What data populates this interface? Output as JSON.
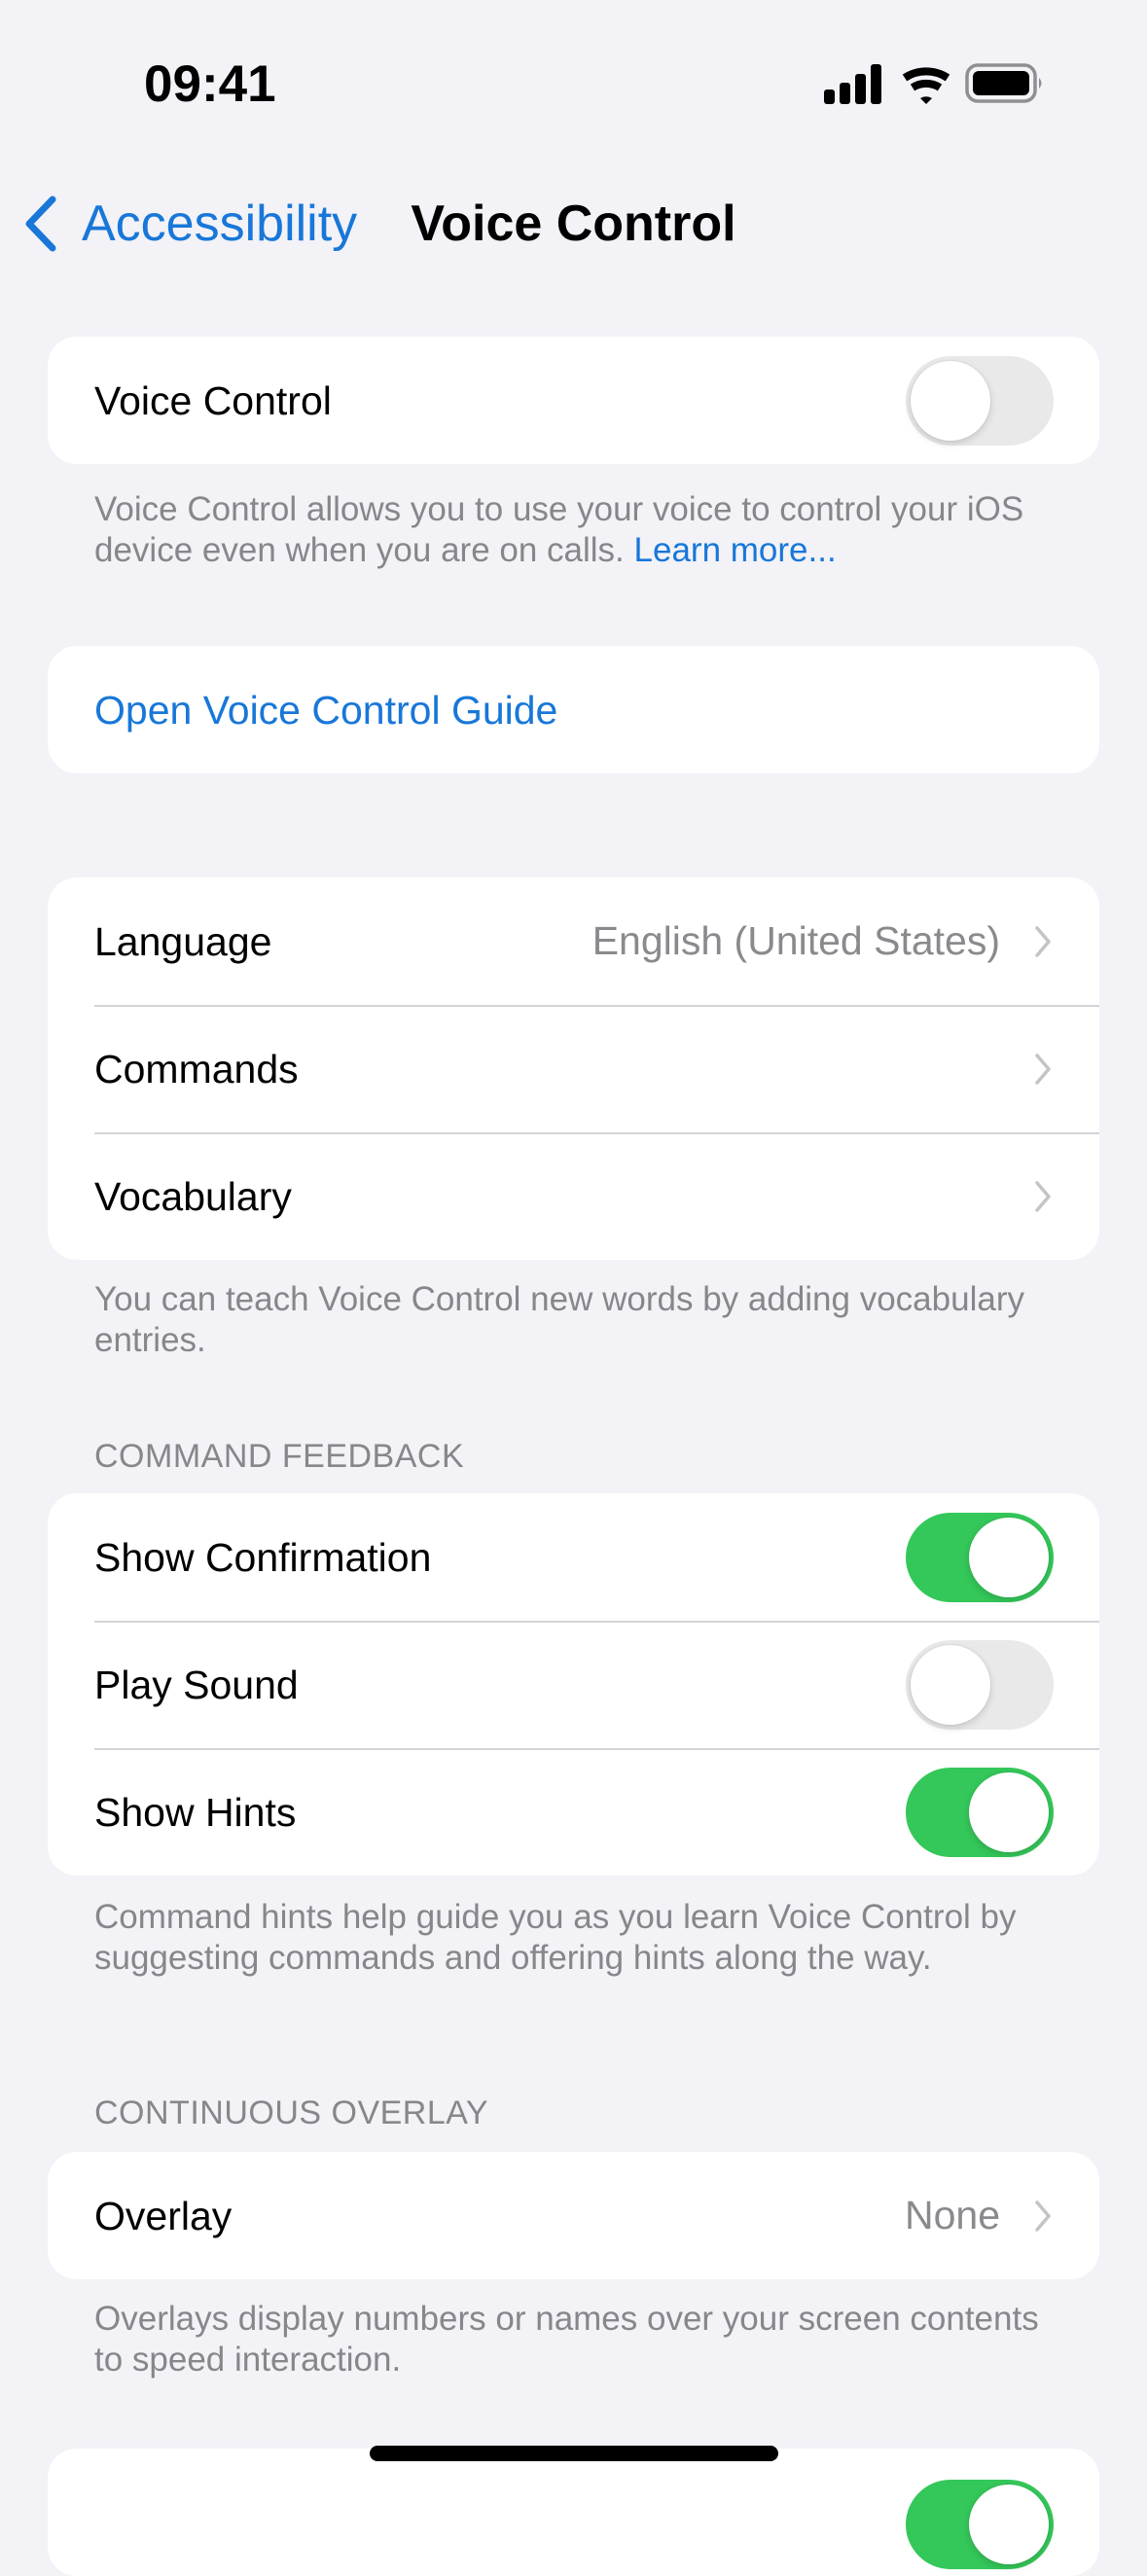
{
  "status_bar": {
    "time": "09:41",
    "icons": [
      "cellular-signal-icon",
      "wifi-icon",
      "battery-icon"
    ]
  },
  "nav": {
    "back_label": "Accessibility",
    "back_icon": "chevron-left-icon",
    "title": "Voice Control"
  },
  "colors": {
    "accent": "#1877d8",
    "toggle_on": "#34c759",
    "toggle_off": "#e9e9ea",
    "background": "#f2f2f7",
    "secondary_text": "#86868b"
  },
  "voice_control": {
    "label": "Voice Control",
    "enabled": false,
    "footer_text": "Voice Control allows you to use your voice to control your iOS device even when you are on calls.",
    "footer_link": "Learn more..."
  },
  "guide": {
    "label": "Open Voice Control Guide"
  },
  "settings_group": {
    "rows": [
      {
        "label": "Language",
        "value": "English (United States)"
      },
      {
        "label": "Commands",
        "value": ""
      },
      {
        "label": "Vocabulary",
        "value": ""
      }
    ],
    "footer_text": "You can teach Voice Control new words by adding vocabulary entries."
  },
  "command_feedback": {
    "header": "COMMAND FEEDBACK",
    "rows": [
      {
        "label": "Show Confirmation",
        "enabled": true
      },
      {
        "label": "Play Sound",
        "enabled": false
      },
      {
        "label": "Show Hints",
        "enabled": true
      }
    ],
    "footer_text": "Command hints help guide you as you learn Voice Control by suggesting commands and offering hints along the way."
  },
  "continuous_overlay": {
    "header": "CONTINUOUS OVERLAY",
    "rows": [
      {
        "label": "Overlay",
        "value": "None"
      }
    ],
    "footer_text": "Overlays display numbers or names over your screen contents to speed interaction."
  },
  "next_section": {
    "partial_toggle_enabled": true
  }
}
